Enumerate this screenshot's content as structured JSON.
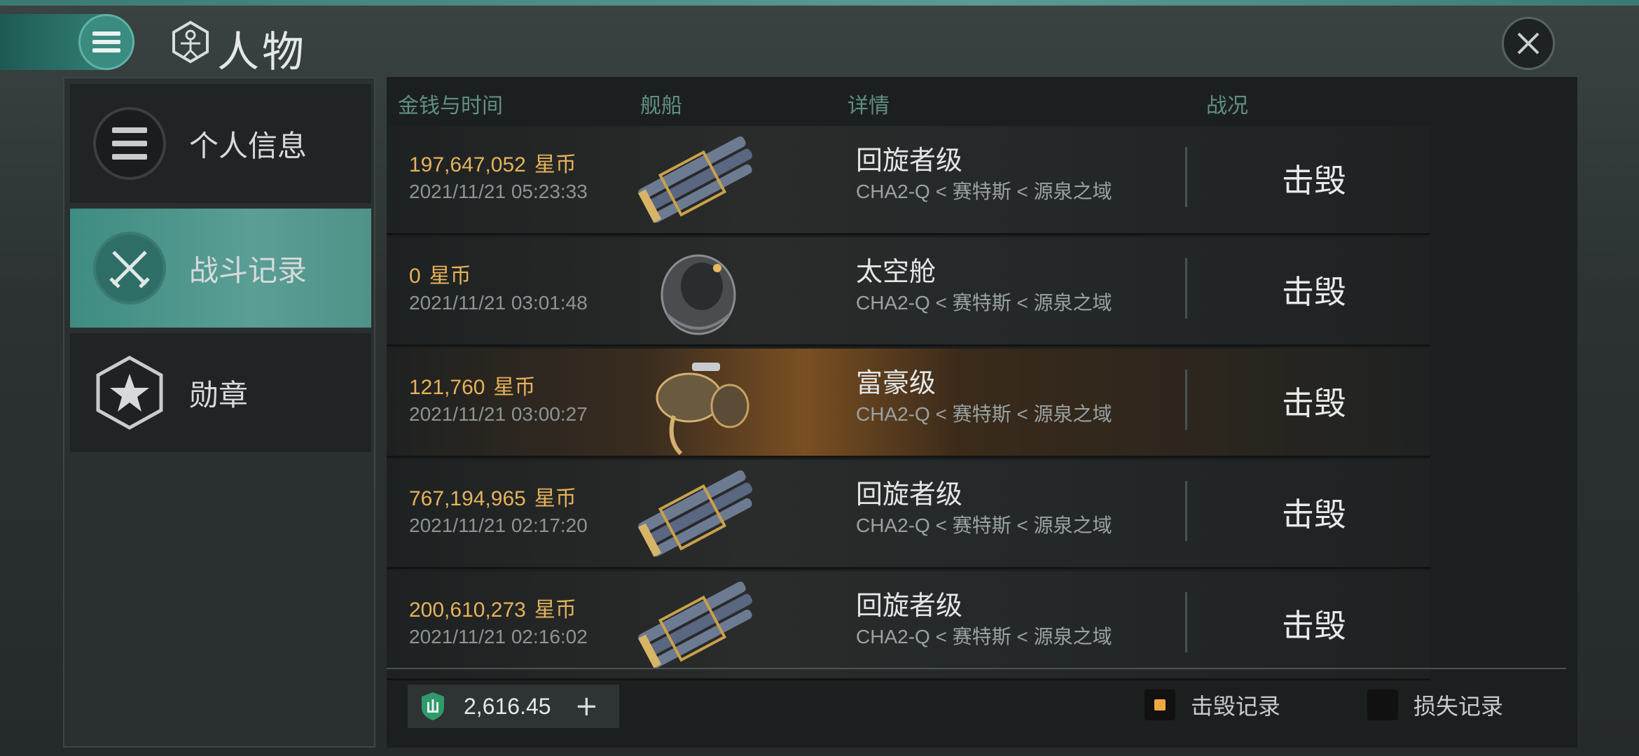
{
  "header": {
    "title": "人物"
  },
  "sidebar": {
    "items": [
      {
        "label": "个人信息",
        "icon": "list-icon",
        "active": false
      },
      {
        "label": "战斗记录",
        "icon": "crossed-swords-icon",
        "active": true
      },
      {
        "label": "勋章",
        "icon": "star-badge-icon",
        "active": false
      }
    ]
  },
  "table": {
    "columns": {
      "money_time": "金钱与时间",
      "ship": "舰船",
      "details": "详情",
      "status": "战况"
    },
    "rows": [
      {
        "amount": "197,647,052",
        "unit": "星币",
        "time": "2021/11/21 05:23:33",
        "ship": "回旋者级",
        "location": "CHA2-Q < 赛特斯 < 源泉之域",
        "result": "击毁"
      },
      {
        "amount": "0",
        "unit": "星币",
        "time": "2021/11/21 03:01:48",
        "ship": "太空舱",
        "location": "CHA2-Q < 赛特斯 < 源泉之域",
        "result": "击毁"
      },
      {
        "amount": "121,760",
        "unit": "星币",
        "time": "2021/11/21 03:00:27",
        "ship": "富豪级",
        "location": "CHA2-Q < 赛特斯 < 源泉之域",
        "result": "击毁"
      },
      {
        "amount": "767,194,965",
        "unit": "星币",
        "time": "2021/11/21 02:17:20",
        "ship": "回旋者级",
        "location": "CHA2-Q < 赛特斯 < 源泉之域",
        "result": "击毁"
      },
      {
        "amount": "200,610,273",
        "unit": "星币",
        "time": "2021/11/21 02:16:02",
        "ship": "回旋者级",
        "location": "CHA2-Q < 赛特斯 < 源泉之域",
        "result": "击毁"
      }
    ]
  },
  "footer": {
    "wallet_amount": "2,616.45",
    "wallet_plus": "+",
    "kill_records_label": "击毁记录",
    "loss_records_label": "损失记录"
  },
  "colors": {
    "accent": "#3e8c82",
    "money": "#e6b25a",
    "filter_active": "#f0a840"
  }
}
